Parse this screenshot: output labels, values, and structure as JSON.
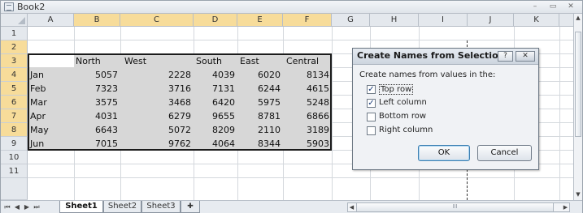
{
  "window": {
    "title": "Book2",
    "minimize_glyph": "–",
    "restore_glyph": "▭",
    "close_glyph": "✕"
  },
  "grid": {
    "columns": [
      "A",
      "B",
      "C",
      "D",
      "E",
      "F",
      "G",
      "H",
      "I",
      "J",
      "K"
    ],
    "rows": [
      "1",
      "2",
      "3",
      "4",
      "5",
      "6",
      "7",
      "8",
      "9",
      "10",
      "11"
    ],
    "headers": [
      "North",
      "West",
      "South",
      "East",
      "Central"
    ],
    "data": [
      {
        "label": "Jan",
        "values": [
          "5057",
          "2228",
          "4039",
          "6020",
          "8134"
        ]
      },
      {
        "label": "Feb",
        "values": [
          "7323",
          "3716",
          "7131",
          "6244",
          "4615"
        ]
      },
      {
        "label": "Mar",
        "values": [
          "3575",
          "3468",
          "6420",
          "5975",
          "5248"
        ]
      },
      {
        "label": "Apr",
        "values": [
          "4031",
          "6279",
          "9655",
          "8781",
          "6866"
        ]
      },
      {
        "label": "May",
        "values": [
          "6643",
          "5072",
          "8209",
          "2110",
          "3189"
        ]
      },
      {
        "label": "Jun",
        "values": [
          "7015",
          "9762",
          "4064",
          "8344",
          "5903"
        ]
      }
    ]
  },
  "dialog": {
    "title": "Create Names from Selection",
    "help_glyph": "?",
    "close_glyph": "✕",
    "prompt": "Create names from values in the:",
    "options": [
      {
        "label": "Top row",
        "checked": true
      },
      {
        "label": "Left column",
        "checked": true
      },
      {
        "label": "Bottom row",
        "checked": false
      },
      {
        "label": "Right column",
        "checked": false
      }
    ],
    "ok_label": "OK",
    "cancel_label": "Cancel",
    "check_glyph": "✓"
  },
  "tabs": {
    "nav": [
      "⏮",
      "◀",
      "▶",
      "⏭"
    ],
    "sheets": [
      "Sheet1",
      "Sheet2",
      "Sheet3"
    ],
    "active": "Sheet1",
    "new_sheet_glyph": "✚"
  },
  "scroll": {
    "left": "◀",
    "right": "▶",
    "up": "▲",
    "down": "▼",
    "grip": "III"
  }
}
